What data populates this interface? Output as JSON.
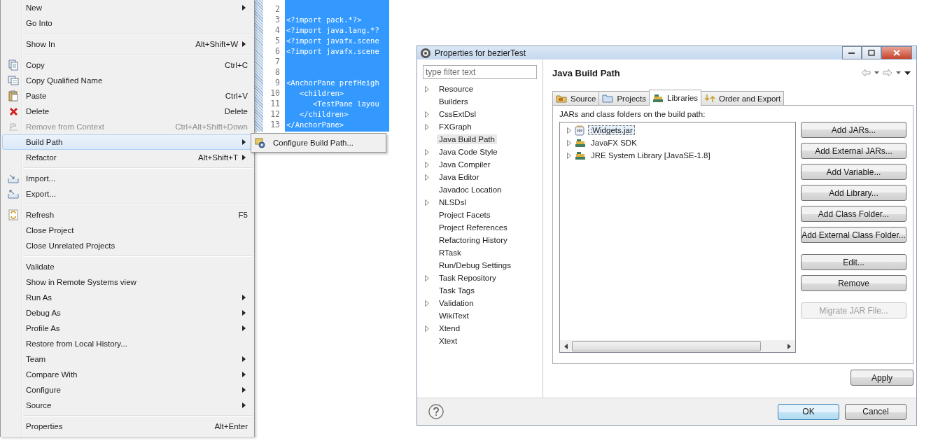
{
  "context_menu": {
    "items": [
      {
        "kind": "item",
        "label": "New",
        "submenu": true,
        "selected": false,
        "disabled": false
      },
      {
        "kind": "item",
        "label": "Go Into",
        "submenu": false,
        "selected": false,
        "disabled": false
      },
      {
        "kind": "separator"
      },
      {
        "kind": "item",
        "label": "Show In",
        "shortcut": "Alt+Shift+W",
        "submenu": true,
        "selected": false,
        "disabled": false
      },
      {
        "kind": "separator"
      },
      {
        "kind": "item",
        "label": "Copy",
        "shortcut": "Ctrl+C",
        "submenu": false,
        "selected": false,
        "disabled": false
      },
      {
        "kind": "item",
        "label": "Copy Qualified Name",
        "submenu": false,
        "selected": false,
        "disabled": false
      },
      {
        "kind": "item",
        "label": "Paste",
        "shortcut": "Ctrl+V",
        "submenu": false,
        "selected": false,
        "disabled": false
      },
      {
        "kind": "item",
        "label": "Delete",
        "shortcut": "Delete",
        "submenu": false,
        "selected": false,
        "disabled": false
      },
      {
        "kind": "item",
        "label": "Remove from Context",
        "shortcut": "Ctrl+Alt+Shift+Down",
        "submenu": false,
        "selected": false,
        "disabled": true
      },
      {
        "kind": "item",
        "label": "Build Path",
        "submenu": true,
        "selected": true,
        "disabled": false
      },
      {
        "kind": "item",
        "label": "Refactor",
        "shortcut": "Alt+Shift+T",
        "submenu": true,
        "selected": false,
        "disabled": false
      },
      {
        "kind": "separator"
      },
      {
        "kind": "item",
        "label": "Import...",
        "submenu": false,
        "selected": false,
        "disabled": false
      },
      {
        "kind": "item",
        "label": "Export...",
        "submenu": false,
        "selected": false,
        "disabled": false
      },
      {
        "kind": "separator"
      },
      {
        "kind": "item",
        "label": "Refresh",
        "shortcut": "F5",
        "submenu": false,
        "selected": false,
        "disabled": false
      },
      {
        "kind": "item",
        "label": "Close Project",
        "submenu": false,
        "selected": false,
        "disabled": false
      },
      {
        "kind": "item",
        "label": "Close Unrelated Projects",
        "submenu": false,
        "selected": false,
        "disabled": false
      },
      {
        "kind": "separator"
      },
      {
        "kind": "item",
        "label": "Validate",
        "submenu": false,
        "selected": false,
        "disabled": false
      },
      {
        "kind": "item",
        "label": "Show in Remote Systems view",
        "submenu": false,
        "selected": false,
        "disabled": false
      },
      {
        "kind": "item",
        "label": "Run As",
        "submenu": true,
        "selected": false,
        "disabled": false
      },
      {
        "kind": "item",
        "label": "Debug As",
        "submenu": true,
        "selected": false,
        "disabled": false
      },
      {
        "kind": "item",
        "label": "Profile As",
        "submenu": true,
        "selected": false,
        "disabled": false
      },
      {
        "kind": "item",
        "label": "Restore from Local History...",
        "submenu": false,
        "selected": false,
        "disabled": false
      },
      {
        "kind": "item",
        "label": "Team",
        "submenu": true,
        "selected": false,
        "disabled": false
      },
      {
        "kind": "item",
        "label": "Compare With",
        "submenu": true,
        "selected": false,
        "disabled": false
      },
      {
        "kind": "item",
        "label": "Configure",
        "submenu": true,
        "selected": false,
        "disabled": false
      },
      {
        "kind": "item",
        "label": "Source",
        "submenu": true,
        "selected": false,
        "disabled": false
      },
      {
        "kind": "separator"
      },
      {
        "kind": "item",
        "label": "Properties",
        "shortcut": "Alt+Enter",
        "submenu": false,
        "selected": false,
        "disabled": false
      }
    ]
  },
  "submenu": {
    "items": [
      {
        "label": "Configure Build Path..."
      }
    ]
  },
  "editor": {
    "lines": [
      {
        "number": "2"
      },
      {
        "number": "3",
        "text": "<?import pack.*?>"
      },
      {
        "number": "4",
        "text": "<?import java.lang.*?"
      },
      {
        "number": "5",
        "text": "<?import javafx.scene"
      },
      {
        "number": "6",
        "text": "<?import javafx.scene"
      },
      {
        "number": "7"
      },
      {
        "number": "8"
      },
      {
        "number": "9",
        "text": "<AnchorPane prefHeigh"
      },
      {
        "number": "10",
        "text": "   <children>"
      },
      {
        "number": "11",
        "text": "      <TestPane layou"
      },
      {
        "number": "12",
        "text": "   </children>"
      },
      {
        "number": "13",
        "text": "</AnchorPane>"
      }
    ]
  },
  "dialog": {
    "title": "Properties for bezierTest",
    "filter": {
      "placeholder": "type filter text"
    },
    "tree": [
      {
        "label": "Resource",
        "expandable": true,
        "selected": false
      },
      {
        "label": "Builders",
        "expandable": false,
        "selected": false
      },
      {
        "label": "CssExtDsl",
        "expandable": true,
        "selected": false
      },
      {
        "label": "FXGraph",
        "expandable": true,
        "selected": false
      },
      {
        "label": "Java Build Path",
        "expandable": false,
        "selected": true
      },
      {
        "label": "Java Code Style",
        "expandable": true,
        "selected": false
      },
      {
        "label": "Java Compiler",
        "expandable": true,
        "selected": false
      },
      {
        "label": "Java Editor",
        "expandable": true,
        "selected": false
      },
      {
        "label": "Javadoc Location",
        "expandable": false,
        "selected": false
      },
      {
        "label": "NLSDsl",
        "expandable": true,
        "selected": false
      },
      {
        "label": "Project Facets",
        "expandable": false,
        "selected": false
      },
      {
        "label": "Project References",
        "expandable": false,
        "selected": false
      },
      {
        "label": "Refactoring History",
        "expandable": false,
        "selected": false
      },
      {
        "label": "RTask",
        "expandable": false,
        "selected": false
      },
      {
        "label": "Run/Debug Settings",
        "expandable": false,
        "selected": false
      },
      {
        "label": "Task Repository",
        "expandable": true,
        "selected": false
      },
      {
        "label": "Task Tags",
        "expandable": false,
        "selected": false
      },
      {
        "label": "Validation",
        "expandable": true,
        "selected": false
      },
      {
        "label": "WikiText",
        "expandable": false,
        "selected": false
      },
      {
        "label": "Xtend",
        "expandable": true,
        "selected": false
      },
      {
        "label": "Xtext",
        "expandable": false,
        "selected": false
      }
    ],
    "page_title": "Java Build Path",
    "tabs": [
      {
        "label": "Source",
        "selected": false
      },
      {
        "label": "Projects",
        "selected": false
      },
      {
        "label": "Libraries",
        "selected": true
      },
      {
        "label": "Order and Export",
        "selected": false
      }
    ],
    "list_label": "JARs and class folders on the build path:",
    "libraries": [
      {
        "kind": "jar",
        "label": ":Widgets.jar",
        "selected": true
      },
      {
        "kind": "library",
        "label": "JavaFX SDK",
        "selected": false
      },
      {
        "kind": "library",
        "label": "JRE System Library [JavaSE-1.8]",
        "selected": false
      }
    ],
    "buttons": [
      {
        "label": "Add JARs...",
        "disabled": false
      },
      {
        "label": "Add External JARs...",
        "disabled": false
      },
      {
        "label": "Add Variable...",
        "disabled": false
      },
      {
        "label": "Add Library...",
        "disabled": false
      },
      {
        "label": "Add Class Folder...",
        "disabled": false
      },
      {
        "label": "Add External Class Folder...",
        "disabled": false
      },
      {
        "label": "Edit...",
        "disabled": false
      },
      {
        "label": "Remove",
        "disabled": false
      },
      {
        "label": "Migrate JAR File...",
        "disabled": true
      }
    ],
    "apply": "Apply",
    "ok": "OK",
    "cancel": "Cancel"
  }
}
